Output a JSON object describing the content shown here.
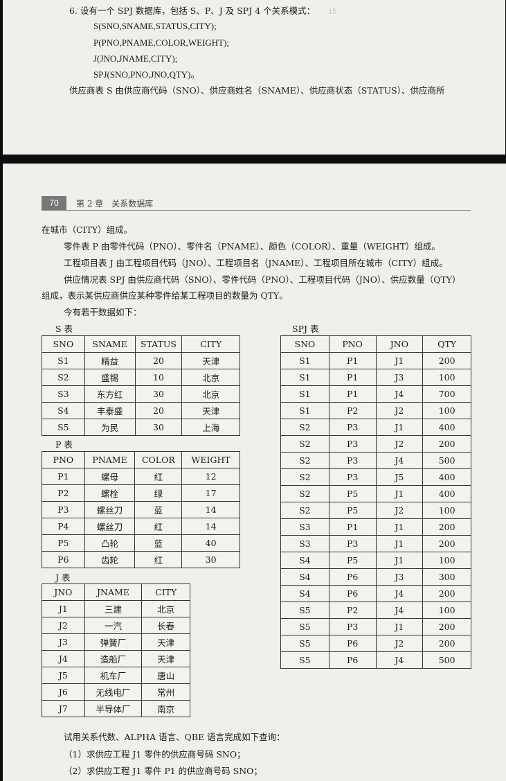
{
  "top_page": {
    "question_heading": "6. 设有一个 SPJ 数据库，包括 S、P、J 及 SPJ 4 个关系模式：",
    "schemas": [
      "S(SNO,SNAME,STATUS,CITY);",
      "P(PNO,PNAME,COLOR,WEIGHT);",
      "J(JNO,JNAME,CITY);",
      "SPJ(SNO,PNO,JNO,QTY)。"
    ],
    "intro_line": "供应商表 S 由供应商代码（SNO）、供应商姓名（SNAME）、供应商状态（STATUS）、供应商所"
  },
  "bottom_page": {
    "page_number": "70",
    "chapter_title": "第 2 章　关系数据库",
    "paragraphs": [
      "在城市（CITY）组成。",
      "零件表 P 由零件代码（PNO）、零件名（PNAME）、颜色（COLOR）、重量（WEIGHT）组成。",
      "工程项目表 J 由工程项目代码（JNO）、工程项目名（JNAME）、工程项目所在城市（CITY）组成。",
      "供应情况表 SPJ 由供应商代码（SNO）、零件代码（PNO）、工程项目代码（JNO）、供应数量（QTY）",
      "组成，表示某供应商供应某种零件给某工程项目的数量为 QTY。",
      "今有若干数据如下："
    ],
    "tables": {
      "s": {
        "label": "S 表",
        "headers": [
          "SNO",
          "SNAME",
          "STATUS",
          "CITY"
        ],
        "rows": [
          [
            "S1",
            "精益",
            "20",
            "天津"
          ],
          [
            "S2",
            "盛锡",
            "10",
            "北京"
          ],
          [
            "S3",
            "东方红",
            "30",
            "北京"
          ],
          [
            "S4",
            "丰泰盛",
            "20",
            "天津"
          ],
          [
            "S5",
            "为民",
            "30",
            "上海"
          ]
        ]
      },
      "p": {
        "label": "P 表",
        "headers": [
          "PNO",
          "PNAME",
          "COLOR",
          "WEIGHT"
        ],
        "rows": [
          [
            "P1",
            "螺母",
            "红",
            "12"
          ],
          [
            "P2",
            "螺栓",
            "绿",
            "17"
          ],
          [
            "P3",
            "螺丝刀",
            "蓝",
            "14"
          ],
          [
            "P4",
            "螺丝刀",
            "红",
            "14"
          ],
          [
            "P5",
            "凸轮",
            "蓝",
            "40"
          ],
          [
            "P6",
            "齿轮",
            "红",
            "30"
          ]
        ]
      },
      "j": {
        "label": "J 表",
        "headers": [
          "JNO",
          "JNAME",
          "CITY"
        ],
        "rows": [
          [
            "J1",
            "三建",
            "北京"
          ],
          [
            "J2",
            "一汽",
            "长春"
          ],
          [
            "J3",
            "弹簧厂",
            "天津"
          ],
          [
            "J4",
            "造船厂",
            "天津"
          ],
          [
            "J5",
            "机车厂",
            "唐山"
          ],
          [
            "J6",
            "无线电厂",
            "常州"
          ],
          [
            "J7",
            "半导体厂",
            "南京"
          ]
        ]
      },
      "spj": {
        "label": "SPJ 表",
        "headers": [
          "SNO",
          "PNO",
          "JNO",
          "QTY"
        ],
        "rows": [
          [
            "S1",
            "P1",
            "J1",
            "200"
          ],
          [
            "S1",
            "P1",
            "J3",
            "100"
          ],
          [
            "S1",
            "P1",
            "J4",
            "700"
          ],
          [
            "S1",
            "P2",
            "J2",
            "100"
          ],
          [
            "S2",
            "P3",
            "J1",
            "400"
          ],
          [
            "S2",
            "P3",
            "J2",
            "200"
          ],
          [
            "S2",
            "P3",
            "J4",
            "500"
          ],
          [
            "S2",
            "P3",
            "J5",
            "400"
          ],
          [
            "S2",
            "P5",
            "J1",
            "400"
          ],
          [
            "S2",
            "P5",
            "J2",
            "100"
          ],
          [
            "S3",
            "P1",
            "J1",
            "200"
          ],
          [
            "S3",
            "P3",
            "J1",
            "200"
          ],
          [
            "S4",
            "P5",
            "J1",
            "100"
          ],
          [
            "S4",
            "P6",
            "J3",
            "300"
          ],
          [
            "S4",
            "P6",
            "J4",
            "200"
          ],
          [
            "S5",
            "P2",
            "J4",
            "100"
          ],
          [
            "S5",
            "P3",
            "J1",
            "200"
          ],
          [
            "S5",
            "P6",
            "J2",
            "200"
          ],
          [
            "S5",
            "P6",
            "J4",
            "500"
          ]
        ]
      }
    },
    "query_intro": "试用关系代数、ALPHA 语言、QBE 语言完成如下查询：",
    "queries": [
      "（1）求供应工程 J1 零件的供应商号码 SNO；",
      "（2）求供应工程 J1 零件 P1 的供应商号码 SNO；"
    ]
  }
}
